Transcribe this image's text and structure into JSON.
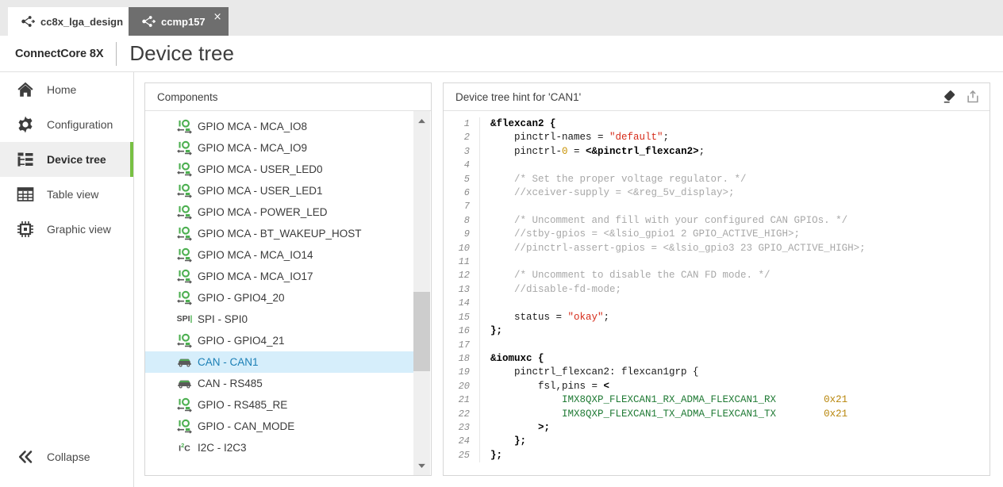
{
  "tabs": [
    {
      "label": "cc8x_lga_design",
      "icon": "share-nodes-icon",
      "close": "×",
      "active": false
    },
    {
      "label": "ccmp157",
      "icon": "share-nodes-icon",
      "close": "×",
      "active": true
    }
  ],
  "header": {
    "brand": "ConnectCore 8X",
    "title": "Device tree"
  },
  "sidebar": {
    "items": [
      {
        "label": "Home",
        "icon": "home-icon",
        "active": false
      },
      {
        "label": "Configuration",
        "icon": "gear-icon",
        "active": false
      },
      {
        "label": "Device tree",
        "icon": "tree-hierarchy-icon",
        "active": true
      },
      {
        "label": "Table view",
        "icon": "table-grid-icon",
        "active": false
      },
      {
        "label": "Graphic view",
        "icon": "chip-icon",
        "active": false
      }
    ],
    "collapse": {
      "label": "Collapse",
      "icon": "double-chevron-left-icon"
    },
    "accent_color": "#78c043",
    "active_background": "#efefef"
  },
  "components_panel": {
    "title": "Components",
    "items": [
      {
        "label": "GPIO MCA - MCA_IO8",
        "icon": "gpio-icon",
        "selected": false
      },
      {
        "label": "GPIO MCA - MCA_IO9",
        "icon": "gpio-icon",
        "selected": false
      },
      {
        "label": "GPIO MCA - USER_LED0",
        "icon": "gpio-icon",
        "selected": false
      },
      {
        "label": "GPIO MCA - USER_LED1",
        "icon": "gpio-icon",
        "selected": false
      },
      {
        "label": "GPIO MCA - POWER_LED",
        "icon": "gpio-icon",
        "selected": false
      },
      {
        "label": "GPIO MCA - BT_WAKEUP_HOST",
        "icon": "gpio-icon",
        "selected": false
      },
      {
        "label": "GPIO MCA - MCA_IO14",
        "icon": "gpio-icon",
        "selected": false
      },
      {
        "label": "GPIO MCA - MCA_IO17",
        "icon": "gpio-icon",
        "selected": false
      },
      {
        "label": "GPIO - GPIO4_20",
        "icon": "gpio-icon",
        "selected": false
      },
      {
        "label": "SPI - SPI0",
        "icon": "spi-icon",
        "selected": false
      },
      {
        "label": "GPIO - GPIO4_21",
        "icon": "gpio-icon",
        "selected": false
      },
      {
        "label": "CAN - CAN1",
        "icon": "can-car-icon",
        "selected": true
      },
      {
        "label": "CAN - RS485",
        "icon": "can-car-icon",
        "selected": false
      },
      {
        "label": "GPIO - RS485_RE",
        "icon": "gpio-icon",
        "selected": false
      },
      {
        "label": "GPIO - CAN_MODE",
        "icon": "gpio-icon",
        "selected": false
      },
      {
        "label": "I2C - I2C3",
        "icon": "i2c-icon",
        "selected": false
      }
    ],
    "selected_background": "#d6eefb",
    "selected_text_color": "#1b7fb5",
    "scrollbar": {
      "up_arrow": "▲",
      "down_arrow": "▼"
    }
  },
  "hint_panel": {
    "title": "Device tree hint for 'CAN1'",
    "actions": [
      {
        "name": "eraser-icon",
        "label": "Clear"
      },
      {
        "name": "export-icon",
        "label": "Export"
      }
    ],
    "code_lines": [
      {
        "n": "1",
        "tokens": [
          {
            "t": "&flexcan2 {",
            "c": "k-bold"
          }
        ]
      },
      {
        "n": "2",
        "tokens": [
          {
            "t": "    pinctrl-names = ",
            "c": ""
          },
          {
            "t": "\"default\"",
            "c": "k-str"
          },
          {
            "t": ";",
            "c": ""
          }
        ]
      },
      {
        "n": "3",
        "tokens": [
          {
            "t": "    pinctrl-",
            "c": ""
          },
          {
            "t": "0",
            "c": "k-num"
          },
          {
            "t": " = ",
            "c": ""
          },
          {
            "t": "<&pinctrl_flexcan2>",
            "c": "k-bold"
          },
          {
            "t": ";",
            "c": ""
          }
        ]
      },
      {
        "n": "4",
        "tokens": [
          {
            "t": "",
            "c": ""
          }
        ]
      },
      {
        "n": "5",
        "tokens": [
          {
            "t": "    /* Set the proper voltage regulator. */",
            "c": "k-cmt"
          }
        ]
      },
      {
        "n": "6",
        "tokens": [
          {
            "t": "    //xceiver-supply = <&reg_5v_display>;",
            "c": "k-cmt"
          }
        ]
      },
      {
        "n": "7",
        "tokens": [
          {
            "t": "",
            "c": ""
          }
        ]
      },
      {
        "n": "8",
        "tokens": [
          {
            "t": "    /* Uncomment and fill with your configured CAN GPIOs. */",
            "c": "k-cmt"
          }
        ]
      },
      {
        "n": "9",
        "tokens": [
          {
            "t": "    //stby-gpios = <&lsio_gpio1 2 GPIO_ACTIVE_HIGH>;",
            "c": "k-cmt"
          }
        ]
      },
      {
        "n": "10",
        "tokens": [
          {
            "t": "    //pinctrl-assert-gpios = <&lsio_gpio3 23 GPIO_ACTIVE_HIGH>;",
            "c": "k-cmt"
          }
        ]
      },
      {
        "n": "11",
        "tokens": [
          {
            "t": "",
            "c": ""
          }
        ]
      },
      {
        "n": "12",
        "tokens": [
          {
            "t": "    /* Uncomment to disable the CAN FD mode. */",
            "c": "k-cmt"
          }
        ]
      },
      {
        "n": "13",
        "tokens": [
          {
            "t": "    //disable-fd-mode;",
            "c": "k-cmt"
          }
        ]
      },
      {
        "n": "14",
        "tokens": [
          {
            "t": "",
            "c": ""
          }
        ]
      },
      {
        "n": "15",
        "tokens": [
          {
            "t": "    status = ",
            "c": ""
          },
          {
            "t": "\"okay\"",
            "c": "k-str"
          },
          {
            "t": ";",
            "c": ""
          }
        ]
      },
      {
        "n": "16",
        "tokens": [
          {
            "t": "};",
            "c": "k-bold"
          }
        ]
      },
      {
        "n": "17",
        "tokens": [
          {
            "t": "",
            "c": ""
          }
        ]
      },
      {
        "n": "18",
        "tokens": [
          {
            "t": "&iomuxc {",
            "c": "k-bold"
          }
        ]
      },
      {
        "n": "19",
        "tokens": [
          {
            "t": "    pinctrl_flexcan2: flexcan1grp {",
            "c": ""
          }
        ]
      },
      {
        "n": "20",
        "tokens": [
          {
            "t": "        fsl,pins = ",
            "c": ""
          },
          {
            "t": "<",
            "c": "k-bold"
          }
        ]
      },
      {
        "n": "21",
        "tokens": [
          {
            "t": "            ",
            "c": ""
          },
          {
            "t": "IMX8QXP_FLEXCAN1_RX_ADMA_FLEXCAN1_RX",
            "c": "k-grn"
          },
          {
            "t": "        ",
            "c": ""
          },
          {
            "t": "0x21",
            "c": "k-hex"
          }
        ]
      },
      {
        "n": "22",
        "tokens": [
          {
            "t": "            ",
            "c": ""
          },
          {
            "t": "IMX8QXP_FLEXCAN1_TX_ADMA_FLEXCAN1_TX",
            "c": "k-grn"
          },
          {
            "t": "        ",
            "c": ""
          },
          {
            "t": "0x21",
            "c": "k-hex"
          }
        ]
      },
      {
        "n": "23",
        "tokens": [
          {
            "t": "        ",
            "c": ""
          },
          {
            "t": ">;",
            "c": "k-bold"
          }
        ]
      },
      {
        "n": "24",
        "tokens": [
          {
            "t": "    ",
            "c": ""
          },
          {
            "t": "};",
            "c": "k-bold"
          }
        ]
      },
      {
        "n": "25",
        "tokens": [
          {
            "t": "};",
            "c": "k-bold"
          }
        ]
      }
    ]
  }
}
